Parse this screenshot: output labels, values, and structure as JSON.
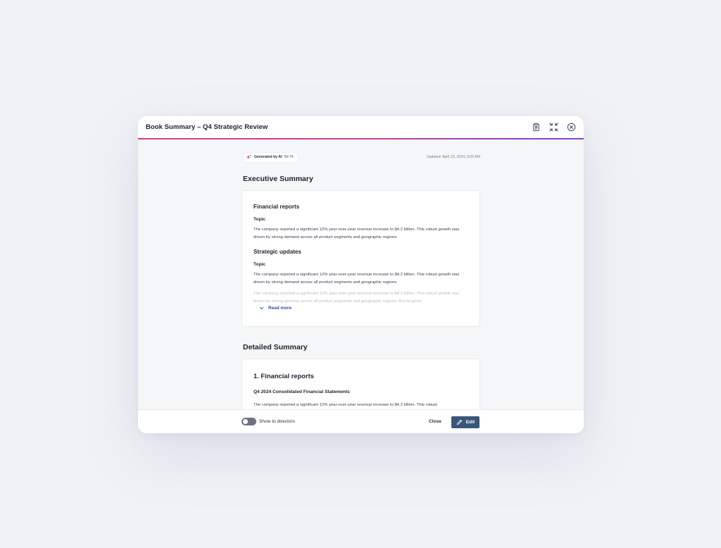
{
  "modal": {
    "title": "Book Summary – Q4 Strategic Review"
  },
  "header_icons": [
    "clipboard-icon",
    "collapse-icon",
    "close-circle-icon"
  ],
  "meta": {
    "ai_label": "Generated by AI",
    "beta": "BETA",
    "updated": "Updated: April 23, 2024, 9:03 AM"
  },
  "executive": {
    "title": "Executive Summary",
    "sections": [
      {
        "heading": "Financial reports",
        "topic": "Topic",
        "text": "The company reported a significant 12% year-over-year revenue increase to $4.2 billion. This robust growth was driven by strong demand across all product segments and geographic regions."
      },
      {
        "heading": "Strategic updates",
        "topic": "Topic",
        "text": "The company reported a significant 12% year-over-year revenue increase to $4.2 billion. This robust growth was driven by strong demand across all product segments and geographic regions."
      }
    ],
    "faded_text": "The company reported a significant 12% year-over-year revenue increase to $4.2 billion. This robust growth was driven by strong demand across all product segments and geographic regions. But its gross",
    "read_more": "Read more"
  },
  "detailed": {
    "title": "Detailed Summary",
    "section_heading": "1.  Financial reports",
    "sub_heading": "Q4 2024 Consolidated Financial Statements",
    "text": "The company reported a significant 12% year-over-year revenue increase to $4.2 billion. This robust"
  },
  "footer": {
    "toggle_label": "Show to directors",
    "toggle_on": false,
    "close_label": "Close",
    "edit_label": "Edit"
  },
  "colors": {
    "accent_gradient_start": "#e4387a",
    "accent_gradient_end": "#8a3cd6",
    "primary_button": "#3a5679",
    "link": "#2f4fa4"
  }
}
